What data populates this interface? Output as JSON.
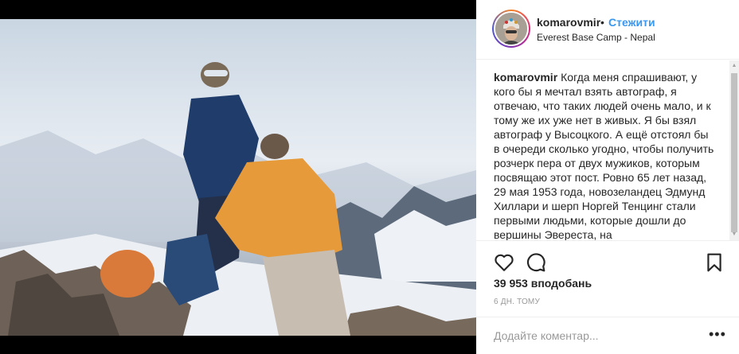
{
  "post": {
    "username": "komarovmir",
    "separator": "•",
    "follow_label": "Стежити",
    "location": "Everest Base Camp - Nepal",
    "caption_user": "komarovmir",
    "caption_text": "Когда меня спрашивают, у кого бы я мечтал взять автограф, я отвечаю, что таких людей очень мало, и к тому же их уже нет в живых. Я бы взял автограф у Высоцкого. А ещё отстоял бы в очереди сколько угодно, чтобы получить розчерк пера от двух мужиков, которым посвящаю этот пост. Ровно 65 лет назад, 29 мая 1953 года, новозеландец Эдмунд Хиллари и шерп Норгей Тенцинг стали первыми людьми, которые дошли до вершины Эвереста, на",
    "likes": "39 953 вподобань",
    "timestamp": "6 ДН. ТОМУ",
    "comment_placeholder": "Додайте коментар...",
    "more_label": "•••"
  },
  "icons": {
    "like": "heart-icon",
    "comment": "comment-icon",
    "save": "bookmark-icon"
  },
  "colors": {
    "link": "#3897f0",
    "text": "#262626",
    "muted": "#999999"
  }
}
